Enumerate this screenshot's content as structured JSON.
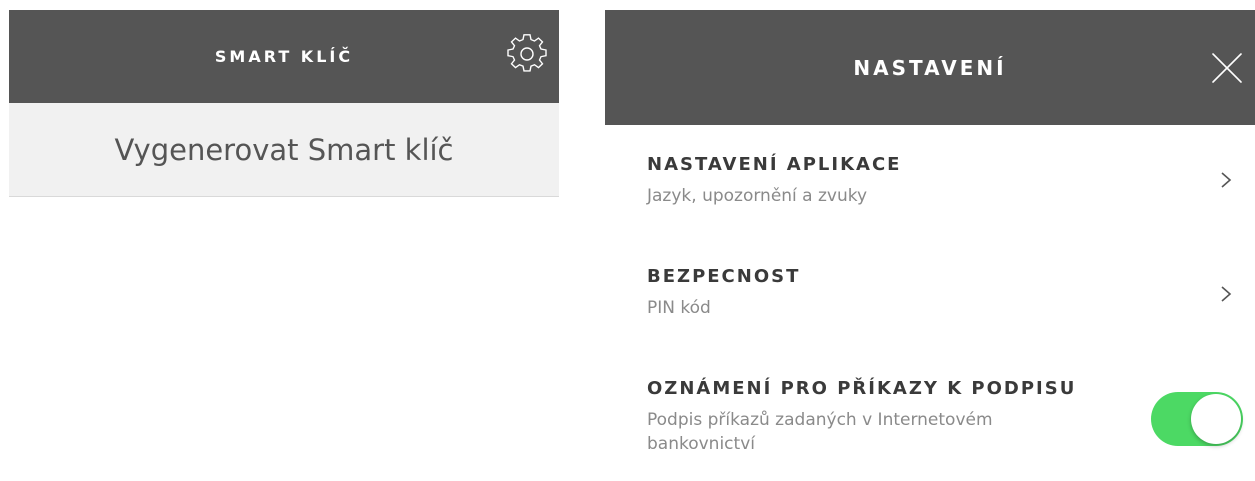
{
  "left_screen": {
    "header": {
      "title": "SMART KLÍČ",
      "icon": "gear-icon"
    },
    "generate_button": {
      "label": "Vygenerovat Smart klíč"
    }
  },
  "right_screen": {
    "header": {
      "title": "NASTAVENÍ",
      "icon": "close-icon"
    },
    "settings": [
      {
        "title": "NASTAVENÍ APLIKACE",
        "subtitle": "Jazyk, upozornění a zvuky",
        "control": "chevron-right-icon"
      },
      {
        "title": "BEZPECNOST",
        "subtitle": "PIN kód",
        "control": "chevron-right-icon"
      },
      {
        "title": "OZNÁMENÍ PRO PŘÍKAZY K PODPISU",
        "subtitle_line1": "Podpis příkazů zadaných v Internetovém",
        "subtitle_line2": "bankovnictví",
        "control": "toggle",
        "toggle_on": true
      }
    ]
  },
  "colors": {
    "header_bg": "#555555",
    "header_text": "#ffffff",
    "row_bg": "#f1f1f1",
    "title_text": "#3a3a3a",
    "subtitle_text": "#8a8a8a",
    "toggle_on": "#4cd964"
  }
}
